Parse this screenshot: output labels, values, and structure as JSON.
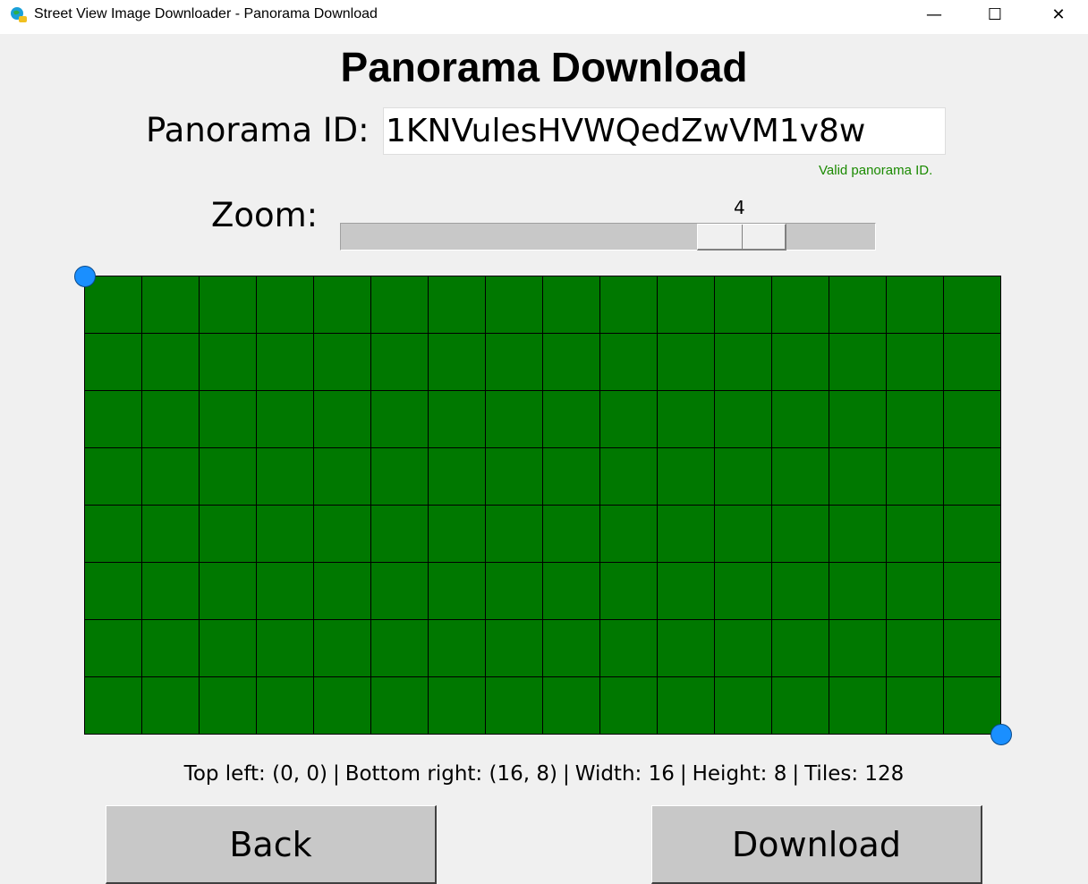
{
  "window": {
    "title": "Street View Image Downloader - Panorama Download",
    "minimize": "—",
    "maximize": "☐",
    "close": "✕"
  },
  "heading": "Panorama Download",
  "panorama_id": {
    "label": "Panorama ID:",
    "value": "1KNVulesHVWQedZwVM1v8w",
    "validation": "Valid panorama ID.",
    "validation_color": "#1a8a00"
  },
  "zoom": {
    "label": "Zoom:",
    "value": "4",
    "min": 0,
    "max": 5
  },
  "tile_grid": {
    "columns": 16,
    "rows": 8,
    "tile_color": "#007800",
    "handle_color": "#1a8fff"
  },
  "status": {
    "top_left": "Top left: (0, 0)",
    "bottom_right": "Bottom right: (16, 8)",
    "width": "Width: 16",
    "height": "Height: 8",
    "tiles": "Tiles: 128",
    "separator": "|"
  },
  "buttons": {
    "back": "Back",
    "download": "Download"
  }
}
